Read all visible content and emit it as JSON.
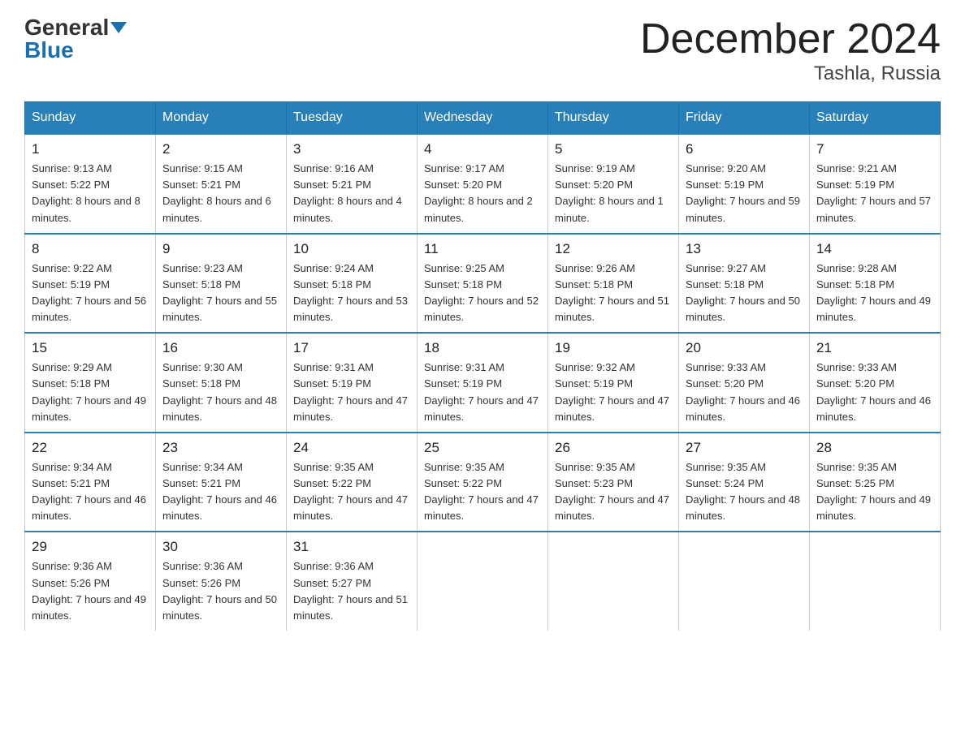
{
  "logo": {
    "general": "General",
    "blue": "Blue"
  },
  "title": "December 2024",
  "subtitle": "Tashla, Russia",
  "days_header": [
    "Sunday",
    "Monday",
    "Tuesday",
    "Wednesday",
    "Thursday",
    "Friday",
    "Saturday"
  ],
  "weeks": [
    [
      {
        "day": "1",
        "sunrise": "9:13 AM",
        "sunset": "5:22 PM",
        "daylight": "8 hours and 8 minutes."
      },
      {
        "day": "2",
        "sunrise": "9:15 AM",
        "sunset": "5:21 PM",
        "daylight": "8 hours and 6 minutes."
      },
      {
        "day": "3",
        "sunrise": "9:16 AM",
        "sunset": "5:21 PM",
        "daylight": "8 hours and 4 minutes."
      },
      {
        "day": "4",
        "sunrise": "9:17 AM",
        "sunset": "5:20 PM",
        "daylight": "8 hours and 2 minutes."
      },
      {
        "day": "5",
        "sunrise": "9:19 AM",
        "sunset": "5:20 PM",
        "daylight": "8 hours and 1 minute."
      },
      {
        "day": "6",
        "sunrise": "9:20 AM",
        "sunset": "5:19 PM",
        "daylight": "7 hours and 59 minutes."
      },
      {
        "day": "7",
        "sunrise": "9:21 AM",
        "sunset": "5:19 PM",
        "daylight": "7 hours and 57 minutes."
      }
    ],
    [
      {
        "day": "8",
        "sunrise": "9:22 AM",
        "sunset": "5:19 PM",
        "daylight": "7 hours and 56 minutes."
      },
      {
        "day": "9",
        "sunrise": "9:23 AM",
        "sunset": "5:18 PM",
        "daylight": "7 hours and 55 minutes."
      },
      {
        "day": "10",
        "sunrise": "9:24 AM",
        "sunset": "5:18 PM",
        "daylight": "7 hours and 53 minutes."
      },
      {
        "day": "11",
        "sunrise": "9:25 AM",
        "sunset": "5:18 PM",
        "daylight": "7 hours and 52 minutes."
      },
      {
        "day": "12",
        "sunrise": "9:26 AM",
        "sunset": "5:18 PM",
        "daylight": "7 hours and 51 minutes."
      },
      {
        "day": "13",
        "sunrise": "9:27 AM",
        "sunset": "5:18 PM",
        "daylight": "7 hours and 50 minutes."
      },
      {
        "day": "14",
        "sunrise": "9:28 AM",
        "sunset": "5:18 PM",
        "daylight": "7 hours and 49 minutes."
      }
    ],
    [
      {
        "day": "15",
        "sunrise": "9:29 AM",
        "sunset": "5:18 PM",
        "daylight": "7 hours and 49 minutes."
      },
      {
        "day": "16",
        "sunrise": "9:30 AM",
        "sunset": "5:18 PM",
        "daylight": "7 hours and 48 minutes."
      },
      {
        "day": "17",
        "sunrise": "9:31 AM",
        "sunset": "5:19 PM",
        "daylight": "7 hours and 47 minutes."
      },
      {
        "day": "18",
        "sunrise": "9:31 AM",
        "sunset": "5:19 PM",
        "daylight": "7 hours and 47 minutes."
      },
      {
        "day": "19",
        "sunrise": "9:32 AM",
        "sunset": "5:19 PM",
        "daylight": "7 hours and 47 minutes."
      },
      {
        "day": "20",
        "sunrise": "9:33 AM",
        "sunset": "5:20 PM",
        "daylight": "7 hours and 46 minutes."
      },
      {
        "day": "21",
        "sunrise": "9:33 AM",
        "sunset": "5:20 PM",
        "daylight": "7 hours and 46 minutes."
      }
    ],
    [
      {
        "day": "22",
        "sunrise": "9:34 AM",
        "sunset": "5:21 PM",
        "daylight": "7 hours and 46 minutes."
      },
      {
        "day": "23",
        "sunrise": "9:34 AM",
        "sunset": "5:21 PM",
        "daylight": "7 hours and 46 minutes."
      },
      {
        "day": "24",
        "sunrise": "9:35 AM",
        "sunset": "5:22 PM",
        "daylight": "7 hours and 47 minutes."
      },
      {
        "day": "25",
        "sunrise": "9:35 AM",
        "sunset": "5:22 PM",
        "daylight": "7 hours and 47 minutes."
      },
      {
        "day": "26",
        "sunrise": "9:35 AM",
        "sunset": "5:23 PM",
        "daylight": "7 hours and 47 minutes."
      },
      {
        "day": "27",
        "sunrise": "9:35 AM",
        "sunset": "5:24 PM",
        "daylight": "7 hours and 48 minutes."
      },
      {
        "day": "28",
        "sunrise": "9:35 AM",
        "sunset": "5:25 PM",
        "daylight": "7 hours and 49 minutes."
      }
    ],
    [
      {
        "day": "29",
        "sunrise": "9:36 AM",
        "sunset": "5:26 PM",
        "daylight": "7 hours and 49 minutes."
      },
      {
        "day": "30",
        "sunrise": "9:36 AM",
        "sunset": "5:26 PM",
        "daylight": "7 hours and 50 minutes."
      },
      {
        "day": "31",
        "sunrise": "9:36 AM",
        "sunset": "5:27 PM",
        "daylight": "7 hours and 51 minutes."
      },
      null,
      null,
      null,
      null
    ]
  ]
}
